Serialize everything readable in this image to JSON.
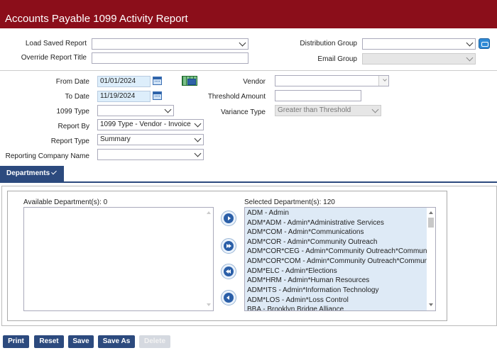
{
  "header": {
    "title": "Accounts Payable 1099 Activity Report"
  },
  "top_form": {
    "load_saved_report_label": "Load Saved Report",
    "load_saved_report_value": "",
    "override_title_label": "Override Report Title",
    "override_title_value": "",
    "distribution_group_label": "Distribution Group",
    "distribution_group_value": "",
    "email_group_label": "Email Group",
    "email_group_value": ""
  },
  "criteria": {
    "from_date_label": "From Date",
    "from_date_value": "01/01/2024",
    "to_date_label": "To Date",
    "to_date_value": "11/19/2024",
    "type_1099_label": "1099 Type",
    "type_1099_value": "",
    "report_by_label": "Report By",
    "report_by_value": "1099 Type - Vendor - Invoice",
    "report_type_label": "Report Type",
    "report_type_value": "Summary",
    "reporting_company_label": "Reporting Company Name",
    "reporting_company_value": "",
    "vendor_label": "Vendor",
    "vendor_value": "",
    "threshold_label": "Threshold Amount",
    "threshold_value": "",
    "variance_label": "Variance Type",
    "variance_value": "Greater than Threshold"
  },
  "departments_tab": {
    "label": "Departments"
  },
  "departments": {
    "available_label": "Available Department(s): 0",
    "selected_label": "Selected Department(s): 120",
    "selected_items": [
      "ADM - Admin",
      "ADM*ADM - Admin*Administrative Services",
      "ADM*COM - Admin*Communications",
      "ADM*COR - Admin*Community Outreach",
      "ADM*COR*CEG - Admin*Community Outreach*Community",
      "ADM*COR*COM - Admin*Community Outreach*Communic",
      "ADM*ELC - Admin*Elections",
      "ADM*HRM - Admin*Human Resources",
      "ADM*ITS - Admin*Information Technology",
      "ADM*LOS - Admin*Loss Control",
      "BBA - Brooklyn Bridge Alliance"
    ]
  },
  "actions": {
    "print": "Print",
    "reset": "Reset",
    "save": "Save",
    "save_as": "Save As",
    "delete": "Delete"
  },
  "colors": {
    "header_bg": "#8b0e1a",
    "accent": "#2c4a7e",
    "selected_list_bg": "#deeaf6"
  }
}
